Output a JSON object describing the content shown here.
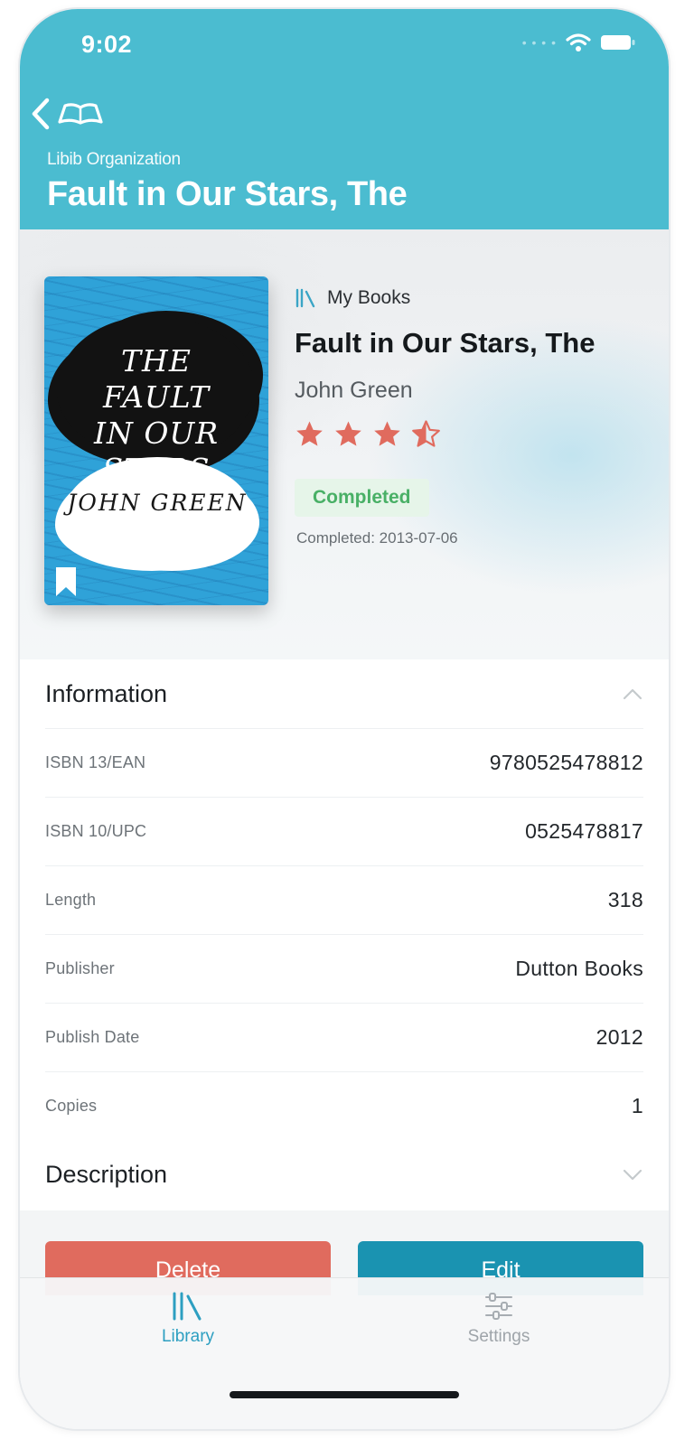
{
  "status_bar": {
    "time": "9:02"
  },
  "header": {
    "organization": "Libib Organization",
    "title": "Fault in Our Stars, The"
  },
  "book": {
    "collection": "My Books",
    "title": "Fault in Our Stars, The",
    "author": "John Green",
    "rating": 3.5,
    "rating_max": 5,
    "status": "Completed",
    "completed_date": "Completed: 2013-07-06",
    "cover": {
      "title_line1": "THE FAULT",
      "title_line2": "IN OUR STARS",
      "author": "JOHN GREEN"
    }
  },
  "information": {
    "title": "Information",
    "rows": [
      {
        "label": "ISBN 13/EAN",
        "value": "9780525478812"
      },
      {
        "label": "ISBN 10/UPC",
        "value": "0525478817"
      },
      {
        "label": "Length",
        "value": "318"
      },
      {
        "label": "Publisher",
        "value": "Dutton Books"
      },
      {
        "label": "Publish Date",
        "value": "2012"
      },
      {
        "label": "Copies",
        "value": "1"
      }
    ]
  },
  "description": {
    "title": "Description"
  },
  "actions": {
    "delete_label": "Delete",
    "edit_label": "Edit"
  },
  "tabbar": {
    "library_label": "Library",
    "settings_label": "Settings"
  },
  "colors": {
    "header": "#4bbcd0",
    "star": "#e06b5e",
    "delete": "#e06b5e",
    "edit": "#1a93b1",
    "completed_text": "#49b066",
    "active_tab": "#2d9fc1"
  }
}
